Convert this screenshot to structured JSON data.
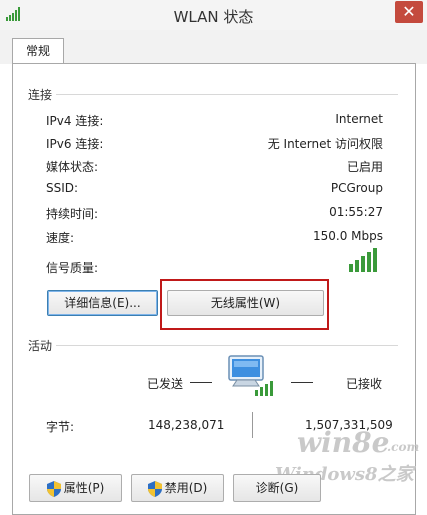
{
  "window": {
    "title": "WLAN 状态",
    "close_glyph": "✕"
  },
  "tabs": [
    {
      "label": "常规"
    }
  ],
  "connection": {
    "header": "连接",
    "rows": [
      {
        "label": "IPv4 连接:",
        "value": "Internet"
      },
      {
        "label": "IPv6 连接:",
        "value": "无 Internet 访问权限"
      },
      {
        "label": "媒体状态:",
        "value": "已启用"
      },
      {
        "label": "SSID:",
        "value": "PCGroup"
      },
      {
        "label": "持续时间:",
        "value": "01:55:27"
      },
      {
        "label": "速度:",
        "value": "150.0 Mbps"
      }
    ],
    "signal_label": "信号质量:",
    "signal_bars": 5,
    "details_button": "详细信息(E)...",
    "wireless_props_button": "无线属性(W)"
  },
  "activity": {
    "header": "活动",
    "sent_label": "已发送",
    "received_label": "已接收",
    "bytes_label": "字节:",
    "bytes_sent": "148,238,071",
    "bytes_received": "1,507,331,509"
  },
  "bottom_buttons": {
    "properties": "属性(P)",
    "disable": "禁用(D)",
    "diagnose": "诊断(G)"
  },
  "watermark": {
    "line1": "win8e",
    "line2": ".com",
    "line3": "Windows8之家"
  },
  "icons": {
    "title_signal": "wifi-signal-icon",
    "shield": "uac-shield-icon",
    "network": "network-computer-icon"
  },
  "colors": {
    "accent": "#3c7fb1",
    "signal_green": "#3a9a3a",
    "highlight_red": "#c01919"
  }
}
